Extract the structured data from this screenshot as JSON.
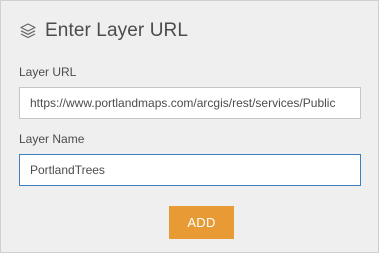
{
  "dialog": {
    "title": "Enter Layer URL",
    "title_icon": "layers-icon"
  },
  "form": {
    "layer_url": {
      "label": "Layer URL",
      "value": "https://www.portlandmaps.com/arcgis/rest/services/Public"
    },
    "layer_name": {
      "label": "Layer Name",
      "value": "PortlandTrees"
    },
    "add_button_label": "ADD"
  },
  "colors": {
    "accent_button": "#e89a34",
    "focused_border": "#3f7fc0",
    "panel_background": "#efefef"
  }
}
